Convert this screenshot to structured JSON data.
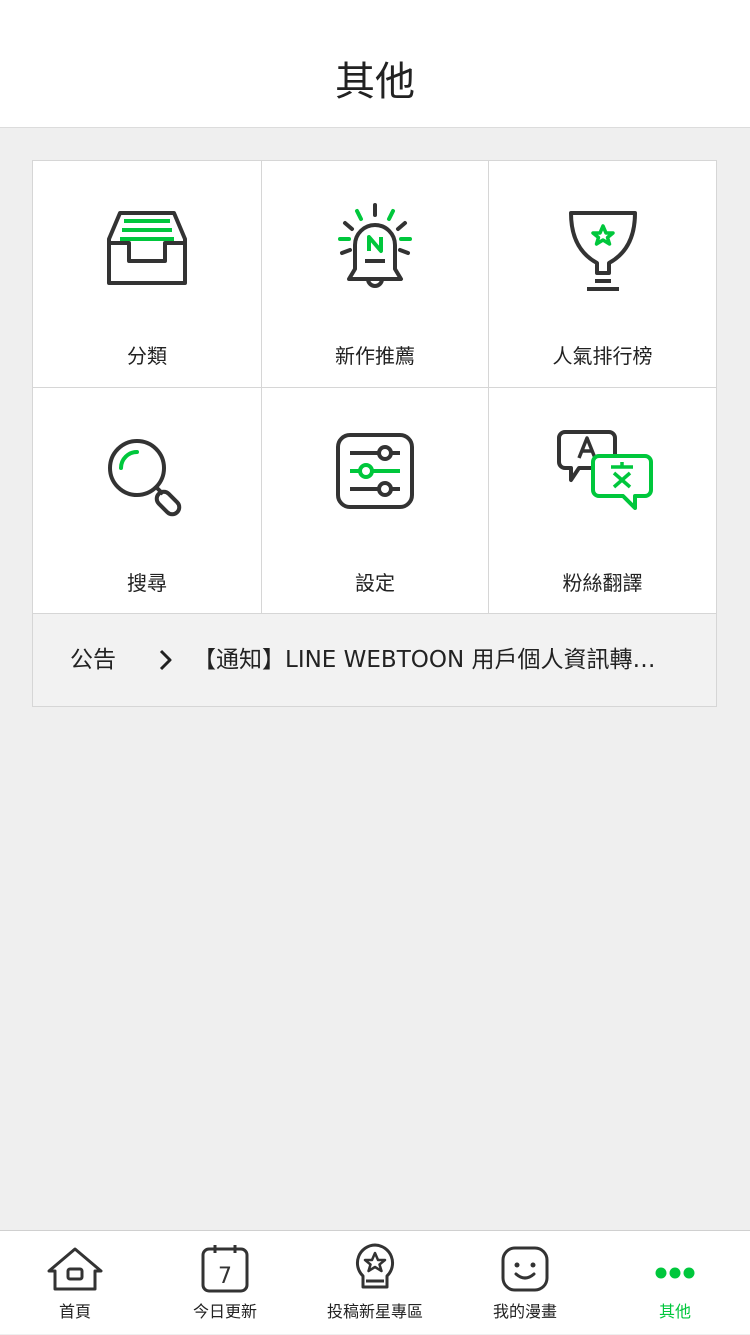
{
  "header": {
    "title": "其他"
  },
  "menu": {
    "items": [
      {
        "label": "分類",
        "icon": "inbox-tray-icon"
      },
      {
        "label": "新作推薦",
        "icon": "new-bell-icon"
      },
      {
        "label": "人氣排行榜",
        "icon": "trophy-cup-icon"
      },
      {
        "label": "搜尋",
        "icon": "magnifier-icon"
      },
      {
        "label": "設定",
        "icon": "sliders-icon"
      },
      {
        "label": "粉絲翻譯",
        "icon": "translate-bubbles-icon"
      }
    ]
  },
  "notice": {
    "label": "公告",
    "text": "【通知】LINE WEBTOON 用戶個人資訊轉…"
  },
  "tabbar": {
    "tabs": [
      {
        "label": "首頁",
        "icon": "home-icon"
      },
      {
        "label": "今日更新",
        "icon": "calendar-7-icon",
        "badge": "7"
      },
      {
        "label": "投稿新星專區",
        "icon": "star-bulb-icon"
      },
      {
        "label": "我的漫畫",
        "icon": "smiley-icon"
      },
      {
        "label": "其他",
        "icon": "more-dots-icon",
        "active": true
      }
    ]
  },
  "colors": {
    "accent": "#00c73c",
    "icon_dark": "#333333"
  }
}
